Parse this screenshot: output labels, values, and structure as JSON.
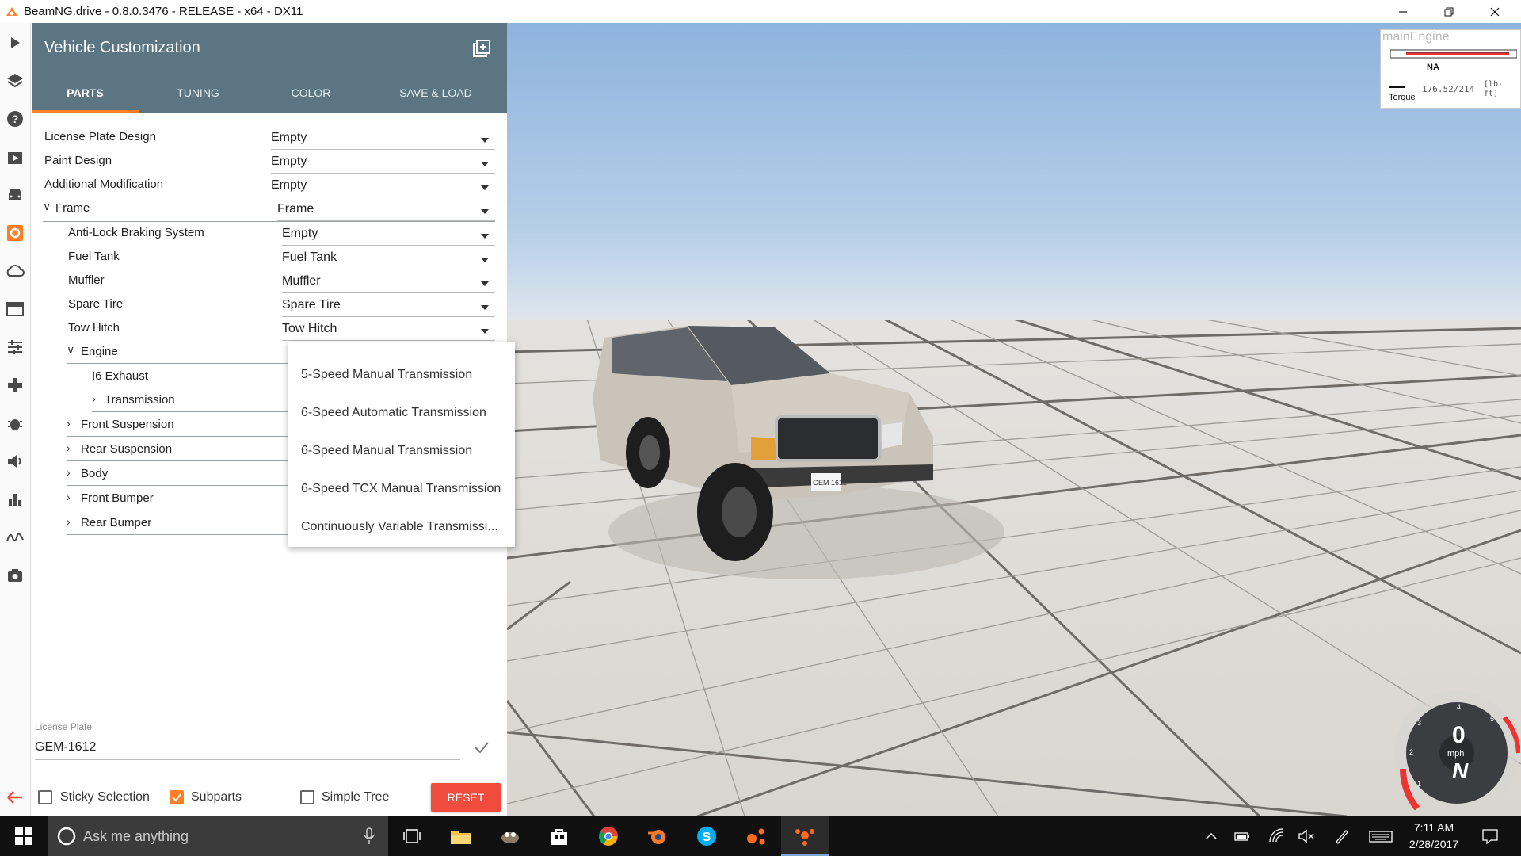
{
  "window": {
    "title": "BeamNG.drive - 0.8.0.3476 - RELEASE - x64 - DX11",
    "controls": [
      "minimize",
      "restore",
      "close"
    ]
  },
  "sidebar_icons": [
    "play-icon",
    "layers-icon",
    "help-icon",
    "video-icon",
    "car-icon",
    "parts-icon",
    "cloud-icon",
    "environment-icon",
    "tuning-sliders-icon",
    "gamepad-icon",
    "bug-icon",
    "volume-icon",
    "bar-chart-icon",
    "signature-icon",
    "camera-icon",
    "back-arrow-icon"
  ],
  "panel": {
    "title": "Vehicle Customization",
    "tabs": [
      {
        "label": "PARTS",
        "active": true
      },
      {
        "label": "TUNING",
        "active": false
      },
      {
        "label": "COLOR",
        "active": false
      },
      {
        "label": "SAVE & LOAD",
        "active": false
      }
    ],
    "rows": [
      {
        "label": "License Plate Design",
        "value": "Empty"
      },
      {
        "label": "Paint Design",
        "value": "Empty"
      },
      {
        "label": "Additional Modification",
        "value": "Empty"
      },
      {
        "label": "Frame",
        "value": "Frame",
        "expanded": true
      },
      {
        "label": "Anti-Lock Braking System",
        "value": "Empty"
      },
      {
        "label": "Fuel Tank",
        "value": "Fuel Tank"
      },
      {
        "label": "Muffler",
        "value": "Muffler"
      },
      {
        "label": "Spare Tire",
        "value": "Spare Tire"
      },
      {
        "label": "Tow Hitch",
        "value": "Tow Hitch"
      },
      {
        "label": "Engine",
        "value": "",
        "expanded": true
      },
      {
        "label": "I6 Exhaust",
        "value": ""
      },
      {
        "label": "Transmission",
        "value": "",
        "expanded": false
      },
      {
        "label": "Front Suspension",
        "value": "",
        "expanded": false
      },
      {
        "label": "Rear Suspension",
        "value": "",
        "expanded": false
      },
      {
        "label": "Body",
        "value": "",
        "expanded": false
      },
      {
        "label": "Front Bumper",
        "value": "",
        "expanded": false
      },
      {
        "label": "Rear Bumper",
        "value": "",
        "expanded": false
      }
    ],
    "dropdown_options": [
      "5-Speed Manual Transmission",
      "6-Speed Automatic Transmission",
      "6-Speed Manual Transmission",
      "6-Speed TCX Manual Transmission",
      "Continuously Variable Transmissi..."
    ],
    "license_plate": {
      "caption": "License Plate",
      "value": "GEM-1612"
    },
    "options": {
      "sticky_selection": {
        "label": "Sticky Selection",
        "checked": false
      },
      "subparts": {
        "label": "Subparts",
        "checked": true
      },
      "simple_tree": {
        "label": "Simple Tree",
        "checked": false
      }
    },
    "reset_label": "RESET"
  },
  "engine_widget": {
    "title": "mainEngine",
    "state": "NA",
    "torque_label": "Torque",
    "torque_value": "176.52/214",
    "torque_unit": "[lb-ft]"
  },
  "gauge": {
    "speed": "0",
    "unit": "mph",
    "gear": "N"
  },
  "taskbar": {
    "search_placeholder": "Ask me anything",
    "clock_time": "7:11 AM",
    "clock_date": "2/28/2017"
  },
  "colors": {
    "accent": "#ff7f26",
    "header": "#5b7583",
    "reset": "#f04b3c"
  }
}
